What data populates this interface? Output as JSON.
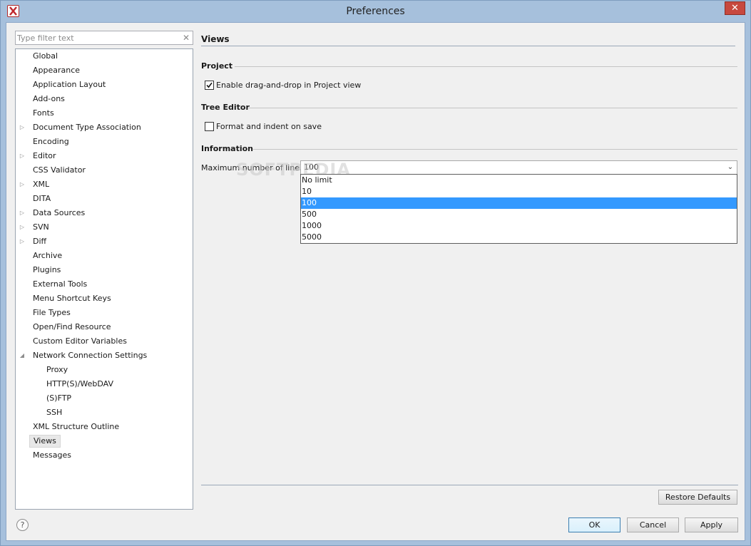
{
  "window": {
    "title": "Preferences",
    "close_symbol": "✕"
  },
  "filter": {
    "placeholder": "Type filter text",
    "clear_symbol": "✕"
  },
  "tree": {
    "items": [
      {
        "label": "Global",
        "level": 0,
        "expander": ""
      },
      {
        "label": "Appearance",
        "level": 0,
        "expander": ""
      },
      {
        "label": "Application Layout",
        "level": 0,
        "expander": ""
      },
      {
        "label": "Add-ons",
        "level": 0,
        "expander": ""
      },
      {
        "label": "Fonts",
        "level": 0,
        "expander": ""
      },
      {
        "label": "Document Type Association",
        "level": 0,
        "expander": "collapsed"
      },
      {
        "label": "Encoding",
        "level": 0,
        "expander": ""
      },
      {
        "label": "Editor",
        "level": 0,
        "expander": "collapsed"
      },
      {
        "label": "CSS Validator",
        "level": 0,
        "expander": ""
      },
      {
        "label": "XML",
        "level": 0,
        "expander": "collapsed"
      },
      {
        "label": "DITA",
        "level": 0,
        "expander": ""
      },
      {
        "label": "Data Sources",
        "level": 0,
        "expander": "collapsed"
      },
      {
        "label": "SVN",
        "level": 0,
        "expander": "collapsed"
      },
      {
        "label": "Diff",
        "level": 0,
        "expander": "collapsed"
      },
      {
        "label": "Archive",
        "level": 0,
        "expander": ""
      },
      {
        "label": "Plugins",
        "level": 0,
        "expander": ""
      },
      {
        "label": "External Tools",
        "level": 0,
        "expander": ""
      },
      {
        "label": "Menu Shortcut Keys",
        "level": 0,
        "expander": ""
      },
      {
        "label": "File Types",
        "level": 0,
        "expander": ""
      },
      {
        "label": "Open/Find Resource",
        "level": 0,
        "expander": ""
      },
      {
        "label": "Custom Editor Variables",
        "level": 0,
        "expander": ""
      },
      {
        "label": "Network Connection Settings",
        "level": 0,
        "expander": "expanded"
      },
      {
        "label": "Proxy",
        "level": 1,
        "expander": ""
      },
      {
        "label": "HTTP(S)/WebDAV",
        "level": 1,
        "expander": ""
      },
      {
        "label": "(S)FTP",
        "level": 1,
        "expander": ""
      },
      {
        "label": "SSH",
        "level": 1,
        "expander": ""
      },
      {
        "label": "XML Structure Outline",
        "level": 0,
        "expander": ""
      },
      {
        "label": "Views",
        "level": 0,
        "expander": "",
        "selected": true
      },
      {
        "label": "Messages",
        "level": 0,
        "expander": ""
      }
    ]
  },
  "page": {
    "title": "Views",
    "project": {
      "title": "Project",
      "dnd_label": "Enable drag-and-drop in Project view",
      "dnd_checked": true
    },
    "tree_editor": {
      "title": "Tree Editor",
      "format_label": "Format and indent on save",
      "format_checked": false
    },
    "information": {
      "title": "Information",
      "max_lines_label": "Maximum number of lines:",
      "max_lines_value": "100",
      "options": [
        "No limit",
        "10",
        "100",
        "500",
        "1000",
        "5000"
      ],
      "highlighted": "100"
    },
    "watermark": "SOFTPEDIA"
  },
  "buttons": {
    "restore_defaults": "Restore Defaults",
    "ok": "OK",
    "cancel": "Cancel",
    "apply": "Apply",
    "help": "?"
  },
  "colors": {
    "selection": "#3399ff",
    "frame": "#a6c0dc",
    "close_button": "#c7483e"
  },
  "icons": {
    "app": "oxygen-x-icon",
    "close": "close-icon",
    "clear": "clear-icon",
    "chevron": "chevron-down-icon",
    "help": "help-icon",
    "expander_collapsed": "triangle-right-icon",
    "expander_expanded": "triangle-down-icon",
    "check": "check-icon"
  }
}
